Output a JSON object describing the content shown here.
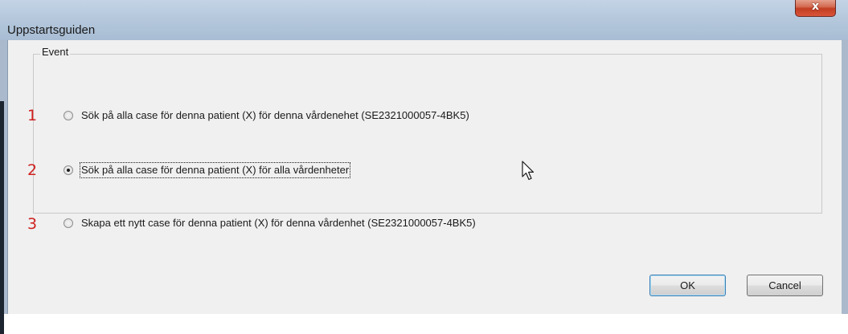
{
  "window": {
    "title": "Uppstartsguiden",
    "close_label": "x"
  },
  "group": {
    "label": "Event",
    "options": [
      {
        "number": "1",
        "label": "Sök på alla case för denna patient (X) för denna vårdenehet (SE2321000057-4BK5)",
        "selected": false
      },
      {
        "number": "2",
        "label": "Sök på alla case för denna patient (X) för alla vårdenheter",
        "selected": true
      },
      {
        "number": "3",
        "label": "Skapa ett nytt case för denna patient (X) för denna vårdenhet (SE2321000057-4BK5)",
        "selected": false
      }
    ]
  },
  "buttons": {
    "ok": "OK",
    "cancel": "Cancel"
  },
  "icons": {
    "cursor": "mouse-pointer-icon",
    "close": "close-icon"
  },
  "colors": {
    "annotation_numbers": "#d02020",
    "close_button": "#c23e22"
  }
}
